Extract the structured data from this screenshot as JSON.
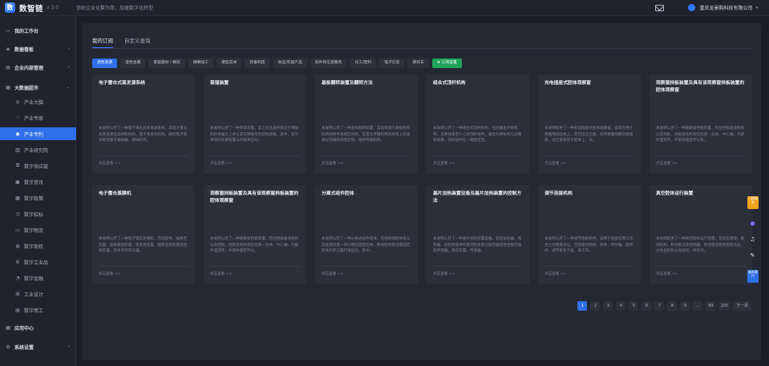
{
  "brand": {
    "logo_char": "数",
    "name": "数智链",
    "version": "v 3.0",
    "slogan": "协助企业化繁为简，加速数字化转型"
  },
  "header": {
    "company": "重庆龙景购科技有限公司",
    "caret": "▾"
  },
  "sidebar": {
    "items": [
      {
        "label": "我的工作台",
        "icon": "▭",
        "name": "sidebar-item-workbench",
        "type": "top",
        "arrow": ""
      },
      {
        "label": "数据看板",
        "icon": "◈",
        "name": "sidebar-item-dashboard",
        "type": "top",
        "arrow": "›"
      },
      {
        "label": "企业内部管理",
        "icon": "▤",
        "name": "sidebar-item-internal",
        "type": "top",
        "arrow": "›"
      },
      {
        "label": "大数据超市",
        "icon": "▦",
        "name": "sidebar-item-bigdata",
        "type": "top",
        "arrow": "⌄"
      },
      {
        "label": "产业大脑",
        "icon": "◎",
        "name": "sidebar-item-brain",
        "type": "sub",
        "arrow": ""
      },
      {
        "label": "产业专家",
        "icon": "♡",
        "name": "sidebar-item-experts",
        "type": "sub",
        "arrow": ""
      },
      {
        "label": "产业专利",
        "icon": "◉",
        "name": "sidebar-item-patents",
        "type": "sub",
        "arrow": "",
        "active": true
      },
      {
        "label": "产业研究院",
        "icon": "▥",
        "name": "sidebar-item-research",
        "type": "sub",
        "arrow": ""
      },
      {
        "label": "数字供应链",
        "icon": "⧉",
        "name": "sidebar-item-supply",
        "type": "sub",
        "arrow": ""
      },
      {
        "label": "数字资讯",
        "icon": "▣",
        "name": "sidebar-item-news",
        "type": "sub",
        "arrow": ""
      },
      {
        "label": "数字政策",
        "icon": "▦",
        "name": "sidebar-item-policy",
        "type": "sub",
        "arrow": ""
      },
      {
        "label": "数字招标",
        "icon": "◷",
        "name": "sidebar-item-tender",
        "type": "sub",
        "arrow": ""
      },
      {
        "label": "数字物流",
        "icon": "▭",
        "name": "sidebar-item-logistics",
        "type": "sub",
        "arrow": ""
      },
      {
        "label": "数字商机",
        "icon": "◍",
        "name": "sidebar-item-opportunity",
        "type": "sub",
        "arrow": ""
      },
      {
        "label": "数字工业品",
        "icon": "⚙",
        "name": "sidebar-item-industrial",
        "type": "sub",
        "arrow": ""
      },
      {
        "label": "数字金融",
        "icon": "◔",
        "name": "sidebar-item-finance",
        "type": "sub",
        "arrow": ""
      },
      {
        "label": "工业设计",
        "icon": "⌘",
        "name": "sidebar-item-design",
        "type": "sub",
        "arrow": ""
      },
      {
        "label": "数字用工",
        "icon": "▤",
        "name": "sidebar-item-labor",
        "type": "sub",
        "arrow": ""
      },
      {
        "label": "应用中心",
        "icon": "▦",
        "name": "sidebar-item-apps",
        "type": "top",
        "arrow": ""
      },
      {
        "label": "系统设置",
        "icon": "⚙",
        "name": "sidebar-item-settings",
        "type": "top",
        "arrow": "›"
      }
    ]
  },
  "tabs": [
    "我的订阅",
    "自定义查询"
  ],
  "chips": [
    "高性资源",
    "蛋色金属",
    "家居建材 / 精装",
    "精细加工",
    "模型实体",
    "装备制造",
    "食品/农副产品",
    "软件和信息服务",
    "化工/塑料",
    "电子信息",
    "摩托车"
  ],
  "subscribe_label": "⊕ 订阅设置",
  "cards": [
    {
      "title": "电子雷击式蒸发源系统",
      "desc": "本发明公开了一种电子束击式蒸发源系统，其电子束击式蒸发源包括材料机构、电子束发生机构、磁控电子等功能及重子偏振器、坩埚机构。",
      "link": "点击查看 >>"
    },
    {
      "title": "蒸馏装置",
      "desc": "本发明公开了一种蒸馏装置，其上的压盖杆能压于释放的封承器之上并与其支撑端可拆卸地连接，其中，处于滑动的支撑装置以内侧来自动。",
      "link": "点击查看 >>"
    },
    {
      "title": "基板翻转装置及翻转方法",
      "desc": "本发明公开了一种基板翻转装置，其具有能内基板机构的所述构件等相应机构。在首先传输机构的局限上形成通过传输机构后实现，提供传输机构。",
      "link": "点击查看 >>"
    },
    {
      "title": "组合式顶杆机构",
      "desc": "本发明公开了一种组合式顶杆机构，包括垂直升降机构、支撑体及至少三组顶杆组件，垂直升降机构与支撑体连接，顶杆组件在一端固定且。",
      "link": "点击查看 >>"
    },
    {
      "title": "充电插座式腔体观察窗",
      "desc": "本发明提供了一种充电插座式腔体观察窗，安装在用于镀膜用的腔体上，其包括法兰盘、保持镀膜观察及玻璃板，法兰盘安装于腔体上，法。",
      "link": "点击查看 >>"
    },
    {
      "title": "观察窗挡板装置及具有该观察窗挡板装置的腔体观察窗",
      "desc": "本发明公开了一种观察窗挡板装置，包括挡板驱动机构以及挡板，挡板驱动机构包括第一主体、中心轴、内部件固定环，外部体固定环以及。",
      "link": "点击查看 >>"
    },
    {
      "title": "电子雷击蒸膜机",
      "desc": "本发明公开了一种电子雷击蒸膜机，包括腔体、抽真空装置、基板输送装置、蒸发源装置、膜厚监控装置及控制装置，腔体内开有与输。",
      "link": "点击查看 >>"
    },
    {
      "title": "观察窗挡板装置及具有该观察窗挡板装置的腔体观察窗",
      "desc": "本发明公开了一种观察窗挡板装置，包括挡板驱动机构以及挡板，挡板驱动机构包括第一主体、中心轴、内部件固定环，外部体固定环以。",
      "link": "点击查看 >>"
    },
    {
      "title": "分离式组件腔体",
      "desc": "本发明公开了一种分离式组件腔体，包括移动腔体及与其连接的第一开口侧的固定腔体，移动腔体能沿着固定腔体的开口面行进运动，其中。",
      "link": "点击查看 >>"
    },
    {
      "title": "基片加热装置设备及基片加热装置的控制方法",
      "desc": "本发明公开了一种基片加热装置设备，包括加热器、电热器、具有所提供的真空腔体及与加热器电性连接的温度传感器，感应装置，传感器。",
      "link": "点击查看 >>"
    },
    {
      "title": "调节连接机构",
      "desc": "本发明公开了一种调节连接机构，该用于连接在两工作台之间用来对位，包括驱动机构、机体、传动轴、旋转杆、调节套及卡盘，两工作。",
      "link": "点击查看 >>"
    },
    {
      "title": "真空腔体运行装置",
      "desc": "本发明提供了一种真空腔体运行装置，包括支撑架、驱动机构、移动板以及控制器，所述驱动机构包括马达、主动齿轮和从动齿轮，所述马。",
      "link": "点击查看 >>"
    }
  ],
  "pagination": {
    "pages": [
      "1",
      "2",
      "3",
      "4",
      "5",
      "6",
      "7",
      "8",
      "9",
      "...",
      "99",
      "100"
    ],
    "current": "1",
    "next_label": "下一页"
  },
  "right_rail": {
    "label1": "已购服务",
    "label2": "服务客户"
  }
}
